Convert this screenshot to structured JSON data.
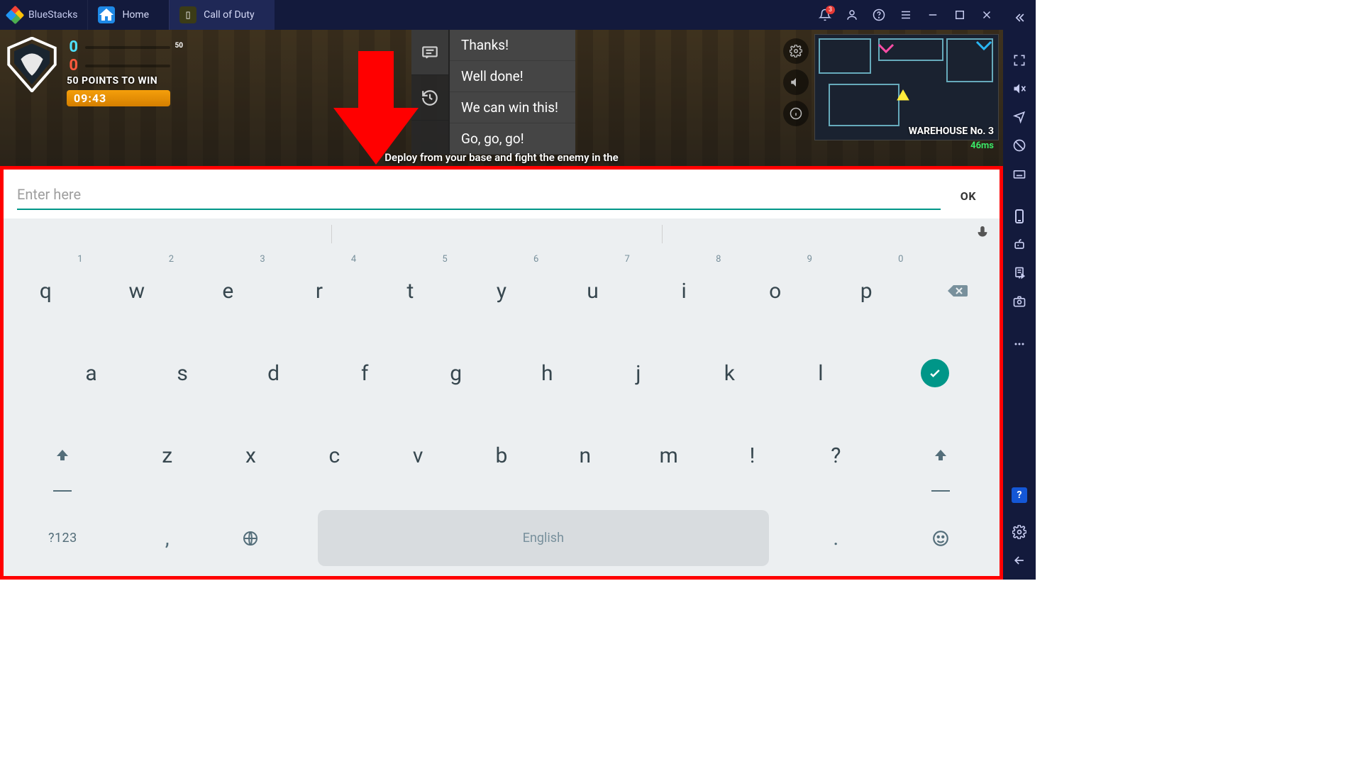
{
  "app": {
    "title": "BlueStacks"
  },
  "tabs": [
    {
      "label": "Home",
      "icon": "home"
    },
    {
      "label": "Call of Duty",
      "icon": "cod"
    }
  ],
  "notifications": {
    "count": "3"
  },
  "hud": {
    "score_a": "0",
    "score_b": "0",
    "score_target": "50",
    "objective": "50 POINTS TO WIN",
    "timer": "09:43",
    "minimap_label": "WAREHOUSE No. 3",
    "ping": "46ms",
    "deploy_text": "Deploy from your base and fight the enemy in the"
  },
  "quick_chat": {
    "items": [
      "Thanks!",
      "Well done!",
      "We can win this!",
      "Go, go, go!"
    ]
  },
  "input": {
    "placeholder": "Enter here",
    "value": "",
    "ok_label": "OK"
  },
  "keyboard": {
    "row1": [
      {
        "k": "q",
        "h": "1"
      },
      {
        "k": "w",
        "h": "2"
      },
      {
        "k": "e",
        "h": "3"
      },
      {
        "k": "r",
        "h": "4"
      },
      {
        "k": "t",
        "h": "5"
      },
      {
        "k": "y",
        "h": "6"
      },
      {
        "k": "u",
        "h": "7"
      },
      {
        "k": "i",
        "h": "8"
      },
      {
        "k": "o",
        "h": "9"
      },
      {
        "k": "p",
        "h": "0"
      }
    ],
    "row2": [
      "a",
      "s",
      "d",
      "f",
      "g",
      "h",
      "j",
      "k",
      "l"
    ],
    "row3": [
      "z",
      "x",
      "c",
      "v",
      "b",
      "n",
      "m",
      "!",
      "?"
    ],
    "symbols_label": "?123",
    "comma": ",",
    "period": ".",
    "space_label": "English"
  }
}
